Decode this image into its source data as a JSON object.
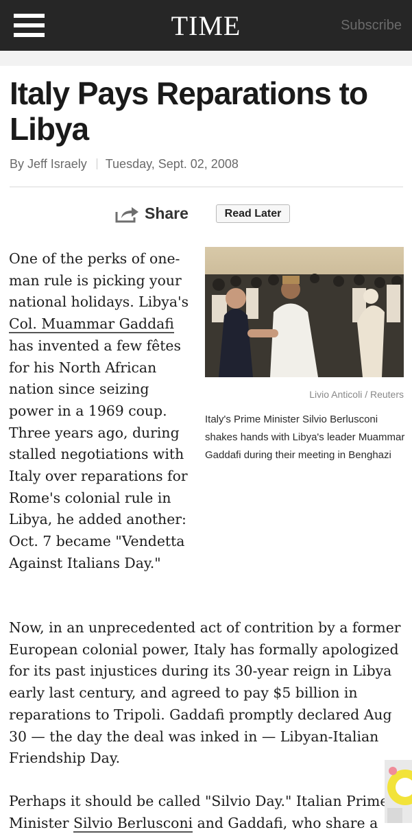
{
  "nav": {
    "logo": "TIME",
    "subscribe": "Subscribe"
  },
  "article": {
    "title": "Italy Pays Reparations to Libya",
    "author": "By Jeff Israely",
    "date": "Tuesday, Sept. 02, 2008",
    "share_label": "Share",
    "read_later_label": "Read Later",
    "photo_credit": "Livio Anticoli / Reuters",
    "photo_caption": "Italy's Prime Minister Silvio Berlusconi shakes hands with Libya's leader Muammar Gaddafi during their meeting in Benghazi",
    "p1_a": "One of the perks of one-man rule is picking your national holidays. Libya's ",
    "p1_link": "Col. Muammar Gaddafi",
    "p1_b": " has invented a few fêtes for his North African nation since seizing power in a 1969 coup. Three years ago, during stalled negotiations with Italy over reparations for Rome's colonial rule in Libya, he added another: Oct. 7 became \"Vendetta Against Italians Day.\"",
    "p2": "Now, in an unprecedented act of contrition by a former European colonial power, Italy has formally apologized for its past injustices during its 30-year reign in Libya early last century, and agreed to pay $5 billion in reparations to Tripoli. Gaddafi promptly declared Aug 30 — the day the deal was inked in — Libyan-Italian Friendship Day.",
    "p3_a": "Perhaps it should be called \"Silvio Day.\" Italian Prime Minister ",
    "p3_link": "Silvio Berlusconi",
    "p3_b": " and Gaddafi, who share a"
  },
  "colors": {
    "nav_bg": "#262626",
    "title_text": "#1a1a1a",
    "meta_text": "#6a6a6a"
  },
  "icons": {
    "menu": "hamburger-icon",
    "share": "share-arrow-icon"
  }
}
